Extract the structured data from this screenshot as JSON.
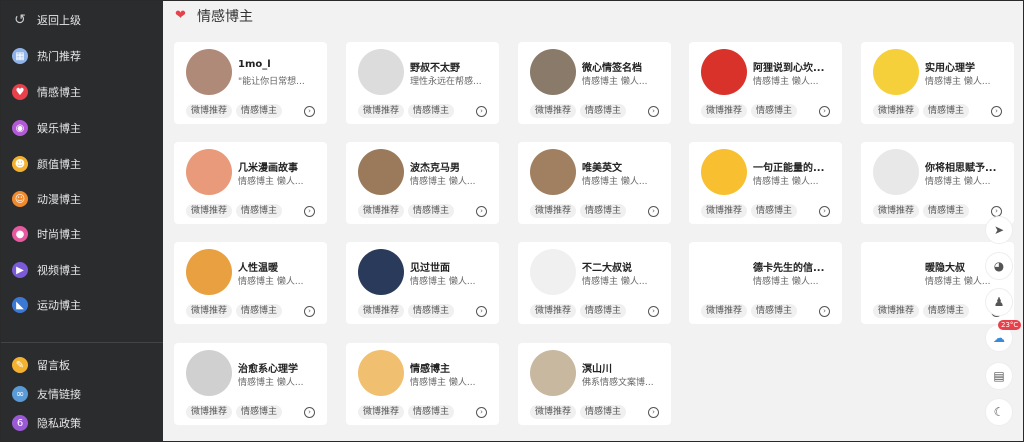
{
  "sidebar": {
    "items": [
      {
        "label": "返回上级",
        "icon": "back-arrow-icon",
        "color": "#cccccc",
        "glyph": "↺"
      },
      {
        "label": "热门推荐",
        "icon": "calendar-icon",
        "color": "#8fb3e8",
        "glyph": "▦"
      },
      {
        "label": "情感博主",
        "icon": "heart-icon",
        "color": "#e8414b",
        "glyph": "♥"
      },
      {
        "label": "娱乐博主",
        "icon": "music-disc-icon",
        "color": "#b25ad6",
        "glyph": "◉"
      },
      {
        "label": "颜值博主",
        "icon": "smile-icon",
        "color": "#f2b230",
        "glyph": "☻"
      },
      {
        "label": "动漫博主",
        "icon": "cartoon-face-icon",
        "color": "#f08a2c",
        "glyph": "☺"
      },
      {
        "label": "时尚博主",
        "icon": "chat-bubble-icon",
        "color": "#e85aa0",
        "glyph": "●"
      },
      {
        "label": "视频博主",
        "icon": "video-icon",
        "color": "#7a5ad6",
        "glyph": "▶"
      },
      {
        "label": "运动博主",
        "icon": "sport-shoe-icon",
        "color": "#3a7ad6",
        "glyph": "◣"
      }
    ],
    "bottom": [
      {
        "label": "留言板",
        "icon": "edit-note-icon",
        "color": "#f2b230",
        "glyph": "✎"
      },
      {
        "label": "友情链接",
        "icon": "link-icon",
        "color": "#5a9ad6",
        "glyph": "∞"
      },
      {
        "label": "隐私政策",
        "icon": "privacy-icon",
        "color": "#9a5ad6",
        "glyph": "6"
      }
    ]
  },
  "main": {
    "title": "情感博主",
    "tag1": "微博推荐",
    "tag2": "情感博主",
    "cards": [
      {
        "name": "1mo_l",
        "desc": "\"能让你日常想...",
        "avatar": "#b08a78"
      },
      {
        "name": "野叔不太野",
        "desc": "理性永远在帮感...",
        "avatar": "#dcdcdc"
      },
      {
        "name": "微心情签名档",
        "desc": "情感博主 懒人...",
        "avatar": "#8a7a6a"
      },
      {
        "name": "阿狸说到心坎...",
        "desc": "情感博主 懒人...",
        "avatar": "#d8322a"
      },
      {
        "name": "实用心理学",
        "desc": "情感博主 懒人...",
        "avatar": "#f5d03a"
      },
      {
        "name": "几米漫画故事",
        "desc": "情感博主 懒人...",
        "avatar": "#e89a7a"
      },
      {
        "name": "波杰克马男",
        "desc": "情感博主 懒人...",
        "avatar": "#9a7a5a"
      },
      {
        "name": "唯美英文",
        "desc": "情感博主 懒人...",
        "avatar": "#a08060"
      },
      {
        "name": "一句正能量的...",
        "desc": "情感博主 懒人...",
        "avatar": "#f8c030"
      },
      {
        "name": "你将相思赋予...",
        "desc": "情感博主 懒人...",
        "avatar": "#e8e8e8"
      },
      {
        "name": "人性温暖",
        "desc": "情感博主 懒人...",
        "avatar": "#e8a040"
      },
      {
        "name": "见过世面",
        "desc": "情感博主 懒人...",
        "avatar": "#2a3a5a"
      },
      {
        "name": "不二大叔说",
        "desc": "情感博主 懒人...",
        "avatar": "#f0f0f0"
      },
      {
        "name": "德卡先生的信...",
        "desc": "情感博主 懒人...",
        "avatar": "#ffffff"
      },
      {
        "name": "暖隐大叔",
        "desc": "情感博主 懒人...",
        "avatar": "#ffffff"
      },
      {
        "name": "治愈系心理学",
        "desc": "情感博主 懒人...",
        "avatar": "#d0d0d0"
      },
      {
        "name": "情感博主",
        "desc": "情感博主 懒人...",
        "avatar": "#f0c070"
      },
      {
        "name": "溟山川",
        "desc": "佛系情感文案博...",
        "avatar": "#c8b8a0"
      }
    ]
  },
  "tools": {
    "temp": "23°C"
  }
}
